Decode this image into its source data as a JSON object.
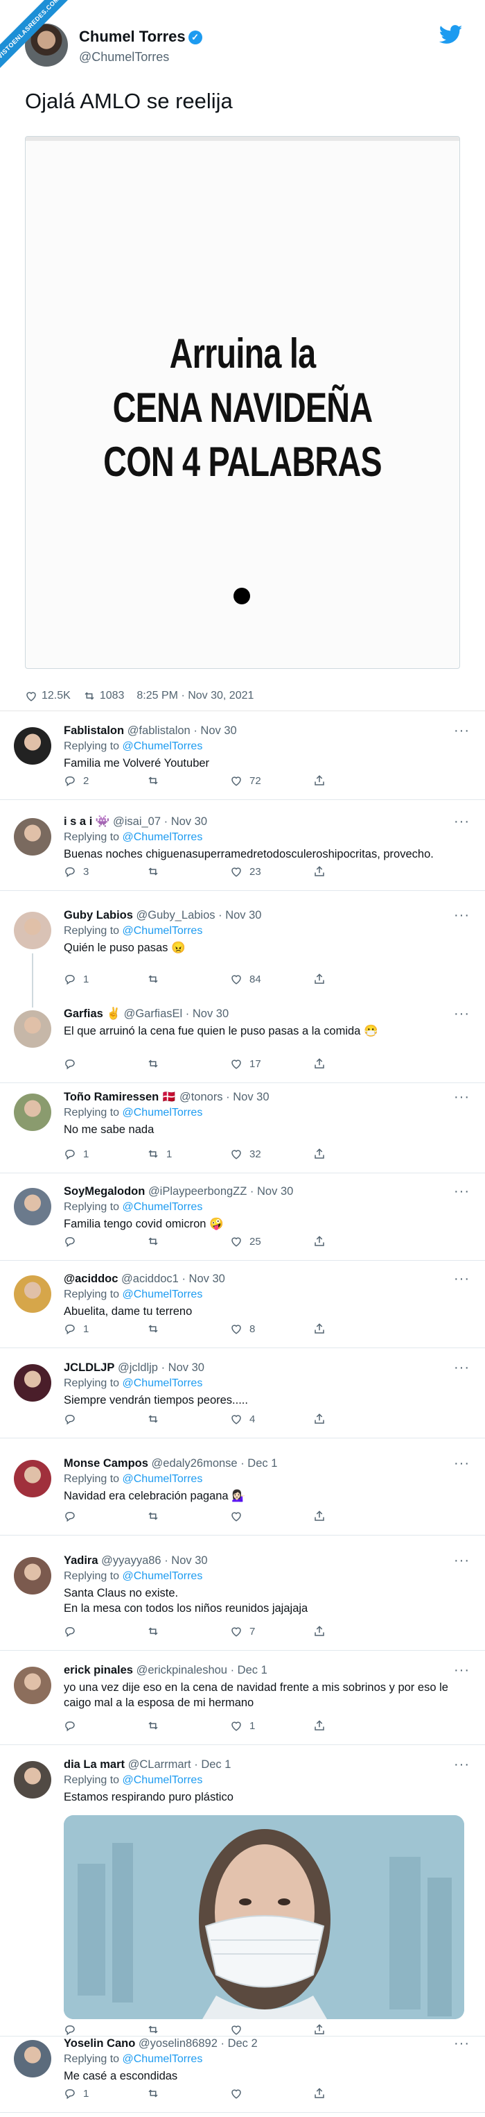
{
  "watermark": "VISTOENLASREDES.COM",
  "main": {
    "name": "Chumel Torres",
    "handle": "@ChumelTorres",
    "verified_mark": "✓",
    "text": "Ojalá AMLO se reelija",
    "image_lines": [
      "Arruina la",
      "CENA NAVIDEÑA",
      "CON 4 PALABRAS"
    ],
    "likes": "12.5K",
    "retweets": "1083",
    "time": "8:25 PM · Nov 30, 2021"
  },
  "replies": [
    {
      "name": "Fablistalon",
      "handle": "@fablistalon",
      "date": "Nov 30",
      "replying_label": "Replying to",
      "replying_to": "@ChumelTorres",
      "text": "Familia me Volveré Youtuber",
      "replies": "2",
      "retweets": "",
      "likes": "72"
    },
    {
      "name": "i s a i 👾",
      "handle": "@isai_07",
      "date": "Nov 30",
      "replying_label": "Replying to",
      "replying_to": "@ChumelTorres",
      "text": "Buenas noches chiguenasuperramedretodosculeroshipocritas, provecho.",
      "replies": "3",
      "retweets": "",
      "likes": "23"
    },
    {
      "name": "Guby Labios",
      "handle": "@Guby_Labios",
      "date": "Nov 30",
      "replying_label": "Replying to",
      "replying_to": "@ChumelTorres",
      "text": "Quién le puso pasas 😠",
      "replies": "1",
      "retweets": "",
      "likes": "84"
    },
    {
      "name": "Garfias ✌",
      "handle": "@GarfiasEl",
      "date": "Nov 30",
      "replying_label": "",
      "replying_to": "",
      "text": "El que arruinó la cena fue quien le puso pasas a la comida 😷",
      "replies": "",
      "retweets": "",
      "likes": "17"
    },
    {
      "name": "Toño Ramiressen 🇩🇰",
      "handle": "@tonors",
      "date": "Nov 30",
      "replying_label": "Replying to",
      "replying_to": "@ChumelTorres",
      "text": "No me sabe nada",
      "replies": "1",
      "retweets": "1",
      "likes": "32"
    },
    {
      "name": "SoyMegalodon",
      "handle": "@iPlaypeerbongZZ",
      "date": "Nov 30",
      "replying_label": "Replying to",
      "replying_to": "@ChumelTorres",
      "text": "Familia tengo covid omicron 🤪",
      "replies": "",
      "retweets": "",
      "likes": "25"
    },
    {
      "name": "@aciddoc",
      "handle": "@aciddoc1",
      "date": "Nov 30",
      "replying_label": "Replying to",
      "replying_to": "@ChumelTorres",
      "text": "Abuelita, dame tu terreno",
      "replies": "1",
      "retweets": "",
      "likes": "8"
    },
    {
      "name": "JCLDLJP",
      "handle": "@jcldljp",
      "date": "Nov 30",
      "replying_label": "Replying to",
      "replying_to": "@ChumelTorres",
      "text": "Siempre vendrán tiempos peores.....",
      "replies": "",
      "retweets": "",
      "likes": "4"
    },
    {
      "name": "Monse Campos",
      "handle": "@edaly26monse",
      "date": "Dec 1",
      "replying_label": "Replying to",
      "replying_to": "@ChumelTorres",
      "text": "Navidad era celebración pagana 💁🏻‍♀️",
      "replies": "",
      "retweets": "",
      "likes": ""
    },
    {
      "name": "Yadira",
      "handle": "@yyayya86",
      "date": "Nov 30",
      "replying_label": "Replying to",
      "replying_to": "@ChumelTorres",
      "text": "Santa Claus no existe.\nEn la mesa con todos los niños reunidos jajajaja",
      "replies": "",
      "retweets": "",
      "likes": "7"
    },
    {
      "name": "erick pinales",
      "handle": "@erickpinaleshou",
      "date": "Dec 1",
      "replying_label": "",
      "replying_to": "",
      "text": "yo una vez dije eso en la cena de navidad frente a mis sobrinos y por eso le caigo mal a la esposa de mi hermano",
      "replies": "",
      "retweets": "",
      "likes": "1"
    },
    {
      "name": "dia La mart",
      "handle": "@CLarrmart",
      "date": "Dec 1",
      "replying_label": "Replying to",
      "replying_to": "@ChumelTorres",
      "text": "Estamos respirando puro plástico",
      "replies": "",
      "retweets": "",
      "likes": ""
    },
    {
      "name": "Yoselin Cano",
      "handle": "@yoselin86892",
      "date": "Dec 2",
      "replying_label": "Replying to",
      "replying_to": "@ChumelTorres",
      "text": "Me casé a escondidas",
      "replies": "1",
      "retweets": "",
      "likes": ""
    }
  ],
  "colors": {
    "accent": "#1d9bf0",
    "muted": "#536471",
    "text": "#0f1419"
  },
  "icons": [
    "verified-icon",
    "twitter-bird-icon",
    "reply-icon",
    "retweet-icon",
    "like-icon",
    "share-icon",
    "more-icon"
  ]
}
